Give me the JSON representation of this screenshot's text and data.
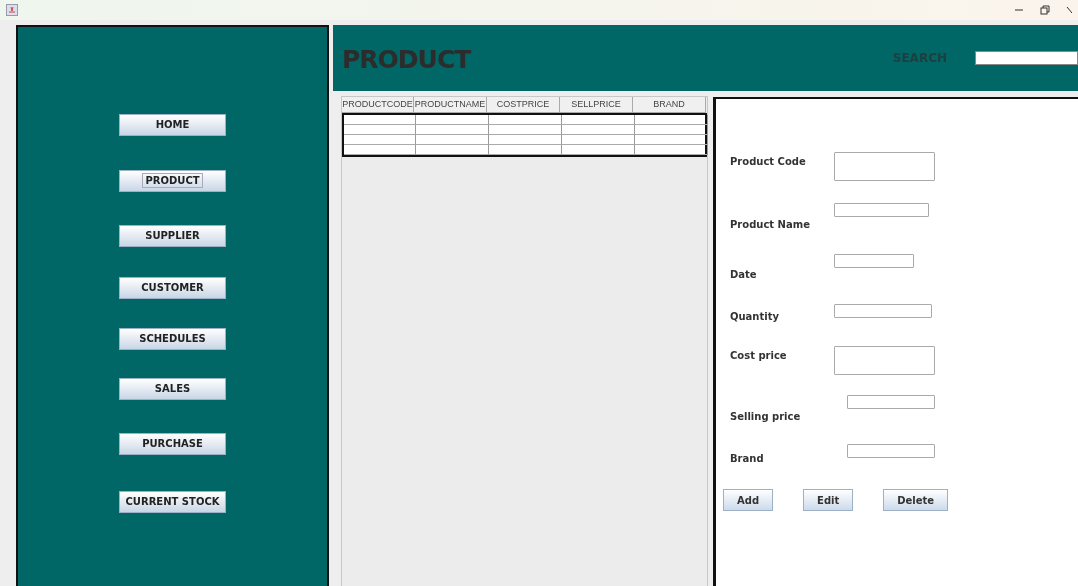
{
  "sidebar": {
    "items": [
      {
        "label": "HOME",
        "selected": false
      },
      {
        "label": "PRODUCT",
        "selected": true
      },
      {
        "label": "SUPPLIER",
        "selected": false
      },
      {
        "label": "CUSTOMER",
        "selected": false
      },
      {
        "label": "SCHEDULES",
        "selected": false
      },
      {
        "label": "SALES",
        "selected": false
      },
      {
        "label": "PURCHASE",
        "selected": false
      },
      {
        "label": "CURRENT STOCK",
        "selected": false
      }
    ]
  },
  "header": {
    "title": "PRODUCT",
    "search_label": "SEARCH"
  },
  "table": {
    "columns": [
      "PRODUCTCODE",
      "PRODUCTNAME",
      "COSTPRICE",
      "SELLPRICE",
      "BRAND"
    ]
  },
  "form": {
    "fields": [
      {
        "label": "Product Code",
        "kind": "tall"
      },
      {
        "label": "Product Name",
        "kind": "short"
      },
      {
        "label": "Date",
        "kind": "short"
      },
      {
        "label": "Quantity",
        "kind": "short"
      },
      {
        "label": "Cost price",
        "kind": "tall"
      },
      {
        "label": "Selling price",
        "kind": "short"
      },
      {
        "label": "Brand",
        "kind": "short"
      }
    ],
    "buttons": [
      "Add",
      "Edit",
      "Delete"
    ]
  }
}
